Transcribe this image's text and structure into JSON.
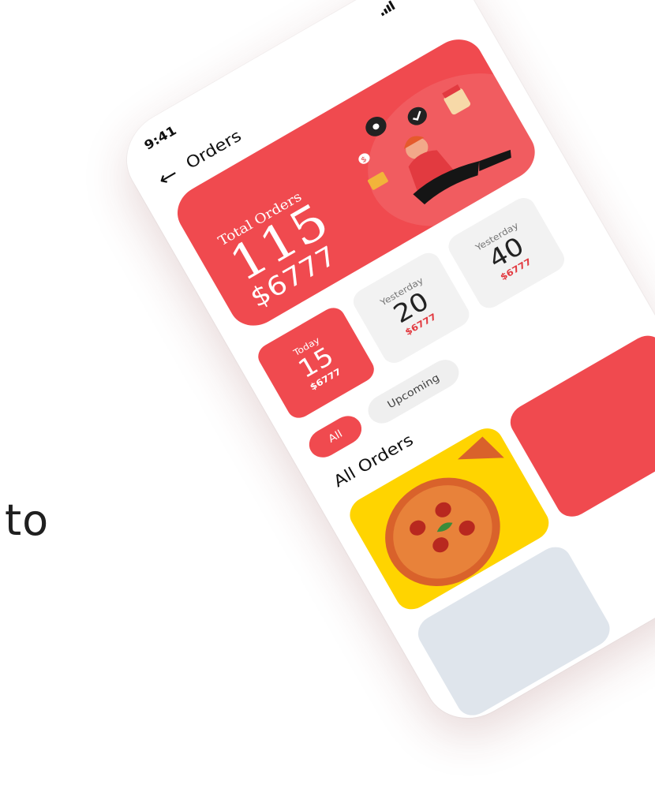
{
  "background": {
    "side_text": "to"
  },
  "status_bar": {
    "time": "9:41"
  },
  "header": {
    "title": "Orders",
    "back_icon": "arrow-left-icon"
  },
  "summary": {
    "label": "Total Orders",
    "count": "115",
    "amount": "$6777",
    "accent_color": "#f04a4f"
  },
  "stats": [
    {
      "label": "Today",
      "value": "15",
      "amount": "$6777",
      "active": true
    },
    {
      "label": "Yesterday",
      "value": "20",
      "amount": "$6777",
      "active": false
    },
    {
      "label": "Yesterday",
      "value": "40",
      "amount": "$6777",
      "active": false
    }
  ],
  "filters": [
    {
      "label": "All",
      "active": true
    },
    {
      "label": "Upcoming",
      "active": false
    }
  ],
  "orders_section": {
    "title": "All Orders"
  }
}
